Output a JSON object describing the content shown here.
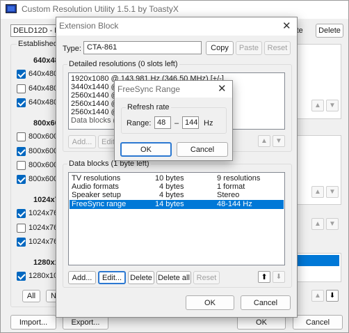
{
  "main_window": {
    "title": "Custom Resolution Utility 1.5.1 by ToastyX",
    "monitor_select": "DELD12D - DE",
    "paste_label": "aste",
    "delete_label": "Delete",
    "established_label": "Established",
    "groups": [
      {
        "heading": "640x48",
        "items": [
          {
            "label": "640x480",
            "checked": true
          },
          {
            "label": "640x480",
            "checked": false
          },
          {
            "label": "640x480",
            "checked": true
          }
        ]
      },
      {
        "heading": "800x60",
        "items": [
          {
            "label": "800x600",
            "checked": false
          },
          {
            "label": "800x600",
            "checked": true
          },
          {
            "label": "800x600",
            "checked": false
          },
          {
            "label": "800x600",
            "checked": true
          }
        ]
      },
      {
        "heading": "1024x7",
        "items": [
          {
            "label": "1024x76",
            "checked": true
          },
          {
            "label": "1024x76",
            "checked": false
          },
          {
            "label": "1024x76",
            "checked": true
          }
        ]
      },
      {
        "heading": "1280x1",
        "items": [
          {
            "label": "1280x10",
            "checked": true
          }
        ]
      }
    ],
    "all_label": "All",
    "n_label": "N",
    "import_label": "Import...",
    "export_label": "Export...",
    "ok_label": "OK",
    "cancel_label": "Cancel"
  },
  "extension_block": {
    "title": "Extension Block",
    "type_label": "Type:",
    "type_value": "CTA-861",
    "copy_label": "Copy",
    "paste_label": "Paste",
    "reset_label": "Reset",
    "detailed_title": "Detailed resolutions (0 slots left)",
    "detailed_rows": [
      "1920x1080 @ 143.981 Hz (346.50 MHz) [+/-]",
      "3440x1440 @",
      "2560x1440 @",
      "2560x1440 @",
      "2560x1440 @",
      "Data blocks ("
    ],
    "detailed_add": "Add...",
    "detailed_edit": "Edit",
    "data_blocks_title": "Data blocks (1 byte left)",
    "data_blocks": [
      {
        "name": "TV resolutions",
        "size": "10 bytes",
        "info": "9 resolutions",
        "selected": false
      },
      {
        "name": "Audio formats",
        "size": "4 bytes",
        "info": "1 format",
        "selected": false
      },
      {
        "name": "Speaker setup",
        "size": "4 bytes",
        "info": "Stereo",
        "selected": false
      },
      {
        "name": "FreeSync range",
        "size": "14 bytes",
        "info": "48-144 Hz",
        "selected": true
      }
    ],
    "db_add": "Add...",
    "db_edit": "Edit...",
    "db_delete": "Delete",
    "db_delete_all": "Delete all",
    "db_reset": "Reset",
    "ok_label": "OK",
    "cancel_label": "Cancel"
  },
  "freesync_dialog": {
    "title": "FreeSync Range",
    "group_label": "Refresh rate",
    "range_label": "Range:",
    "min_value": "48",
    "dash": "–",
    "max_value": "144",
    "unit": "Hz",
    "ok_label": "OK",
    "cancel_label": "Cancel"
  },
  "colors": {
    "selection": "#0078d7",
    "accent_border": "#2b78d1"
  }
}
